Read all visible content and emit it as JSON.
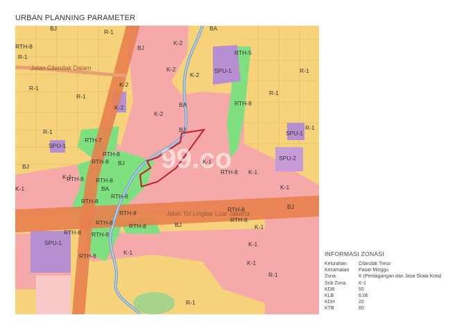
{
  "header": {
    "title": "URBAN PLANNING PARAMETER"
  },
  "map": {
    "watermark": "99.co",
    "roads": [
      {
        "id": "road-cilandak",
        "text": "Jalan Cilandak Dalam"
      },
      {
        "id": "road-toll",
        "text": "Jalan Tol Lingkar Luar Jakarta"
      }
    ],
    "zone_labels": [
      "BJ",
      "R-1",
      "RTH-8",
      "K-2",
      "K-1",
      "SPU-1",
      "SPU-2",
      "RTH-5",
      "RTH-7",
      "BA"
    ],
    "colors": {
      "residential": "#f6d27a",
      "commercial": "#f5a9a9",
      "green": "#7fe07f",
      "public": "#b58fd0",
      "road": "#e8804e",
      "river": "#8fb3d9",
      "parcel_outline": "#c0202a"
    }
  },
  "info": {
    "title": "INFORMASI ZONASI",
    "rows": [
      {
        "key": "Kelurahan",
        "value": "Cilandak Timur"
      },
      {
        "key": "Kecamatan",
        "value": "Pasar Minggu"
      },
      {
        "key": "Zona",
        "value": "K (Perdagangan dan Jasa Skala Kota)"
      },
      {
        "key": "Sub Zona",
        "value": "K-1"
      },
      {
        "key": "KDB",
        "value": "55"
      },
      {
        "key": "KLB",
        "value": "6.06"
      },
      {
        "key": "KDH",
        "value": "20"
      },
      {
        "key": "KTB",
        "value": "60"
      }
    ]
  }
}
